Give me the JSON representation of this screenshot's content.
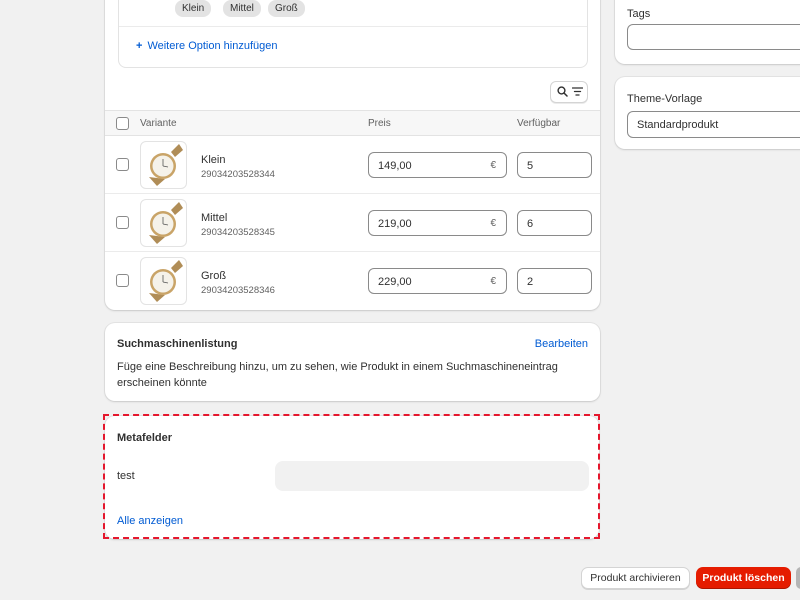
{
  "options": {
    "values": [
      "Klein",
      "Mittel",
      "Groß"
    ],
    "add_option_label": "Weitere Option hinzufügen"
  },
  "variants_table": {
    "headers": {
      "variant": "Variante",
      "price": "Preis",
      "availability": "Verfügbar"
    },
    "rows": [
      {
        "name": "Klein",
        "sku": "29034203528344",
        "price": "149,00",
        "currency": "€",
        "quantity": "5"
      },
      {
        "name": "Mittel",
        "sku": "29034203528345",
        "price": "219,00",
        "currency": "€",
        "quantity": "6"
      },
      {
        "name": "Groß",
        "sku": "29034203528346",
        "price": "229,00",
        "currency": "€",
        "quantity": "2"
      }
    ]
  },
  "seo": {
    "title": "Suchmaschinenlistung",
    "edit_label": "Bearbeiten",
    "description": "Füge eine Beschreibung hinzu, um zu sehen, wie Produkt in einem Suchmaschineneintrag erscheinen könnte"
  },
  "metafields": {
    "title": "Metafelder",
    "field_label": "test",
    "field_value": "",
    "show_all_label": "Alle anzeigen"
  },
  "tags": {
    "label": "Tags",
    "value": ""
  },
  "theme_template": {
    "label": "Theme-Vorlage",
    "value": "Standardprodukt"
  },
  "footer": {
    "archive_label": "Produkt archivieren",
    "delete_label": "Produkt löschen"
  },
  "colors": {
    "link": "#005bd3",
    "danger": "#e51c00",
    "highlight_outline": "#e5172d",
    "background": "#f1f1f1"
  }
}
